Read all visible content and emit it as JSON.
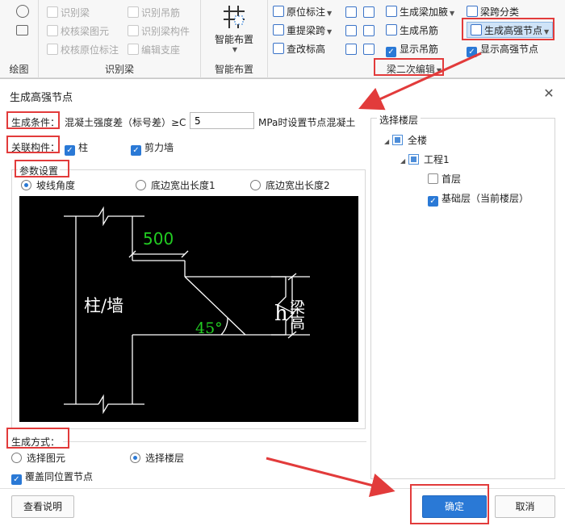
{
  "ribbon": {
    "left_group_title": "绘图",
    "recognize_group": {
      "title": "识别梁",
      "items": [
        "识别梁",
        "校核梁图元",
        "校核原位标注",
        "识别吊筋",
        "识别梁构件",
        "编辑支座"
      ]
    },
    "smart_group": {
      "title": "智能布置",
      "button_label": "智能布置"
    },
    "edit_group": {
      "title": "梁二次编辑",
      "items": [
        "原位标注",
        "重提梁跨",
        "查改标高",
        "生成梁加腋",
        "生成吊筋",
        "显示吊筋",
        "梁跨分类",
        "生成高强节点",
        "显示高强节点"
      ]
    }
  },
  "dialog": {
    "title": "生成高强节点",
    "condition_label": "生成条件：",
    "condition_text": "混凝土强度差（标号差）≥C",
    "condition_value": "5",
    "condition_suffix": "MPa时设置节点混凝土",
    "related_label": "关联构件：",
    "related_options": [
      "柱",
      "剪力墙"
    ],
    "param_label": "参数设置",
    "param_options": [
      "坡线角度",
      "底边宽出长度1",
      "底边宽出长度2"
    ],
    "diagram": {
      "dim_500": "500",
      "column_text": "柱/墙",
      "angle_text": "45°",
      "h_text": "h",
      "beam_height_text": "梁高"
    },
    "method_label": "生成方式：",
    "method_options": [
      "选择图元",
      "选择楼层"
    ],
    "override_label": "覆盖同位置节点",
    "floor_select_label": "选择楼层",
    "tree": {
      "root": "全楼",
      "project": "工程1",
      "floors": [
        "首层",
        "基础层（当前楼层）"
      ]
    },
    "help_button": "查看说明",
    "ok_button": "确定",
    "cancel_button": "取消"
  },
  "colors": {
    "accent": "#2a79d6",
    "annotation": "#e23b3b",
    "diagram_green": "#22cc22"
  }
}
